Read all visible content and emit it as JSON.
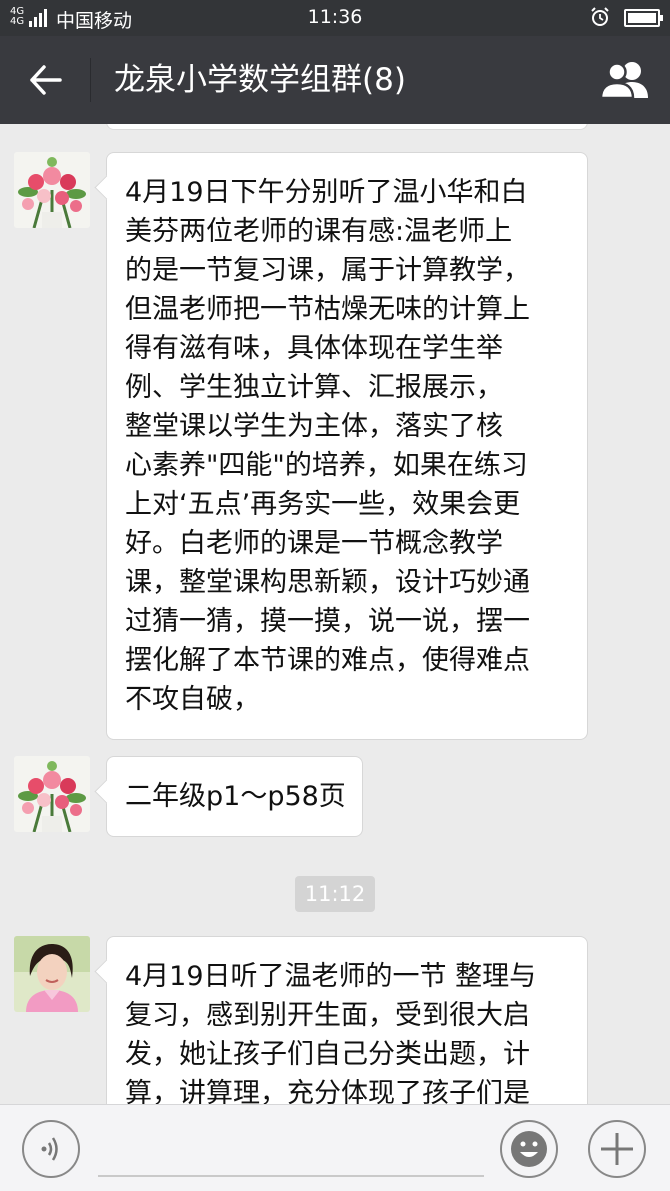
{
  "status_bar": {
    "network_top": "4G",
    "network_bottom": "4G",
    "carrier": "中国移动",
    "time": "11:36",
    "icons": [
      "signal-icon",
      "alarm-icon",
      "battery-icon"
    ],
    "battery_level": 1.0
  },
  "nav": {
    "title": "龙泉小学数学组群(8)",
    "back_icon": "arrow-left-icon",
    "members_icon": "people-icon"
  },
  "messages": [
    {
      "avatar": "flower-bouquet-avatar",
      "lines": [
        "4月19日下午分别听了温小华和白",
        "美芬两位老师的课有感:温老师上",
        "的是一节复习课，属于计算教学，",
        "但温老师把一节枯燥无味的计算上",
        "得有滋有味，具体体现在学生举",
        "例、学生独立计算、汇报展示，",
        "整堂课以学生为主体，落实了核",
        "心素养\"四能\"的培养，如果在练习",
        "上对‘五点’再务实一些，效果会更",
        "好。白老师的课是一节概念教学",
        "课，整堂课构思新颖，设计巧妙通",
        "过猜一猜，摸一摸，说一说，摆一",
        "摆化解了本节课的难点，使得难点",
        "不攻自破，"
      ]
    },
    {
      "avatar": "flower-bouquet-avatar",
      "lines": [
        "二年级p1～p58页"
      ]
    },
    {
      "avatar": "woman-portrait-avatar",
      "lines": [
        "4月19日听了温老师的一节 整理与",
        "复习，感到别开生面，受到很大启",
        "发，她让孩子们自己分类出题，计",
        "算，讲算理，充分体现了孩子们是"
      ]
    }
  ],
  "timestamp": "11:12",
  "input_bar": {
    "voice_icon": "voice-icon",
    "emoji_icon": "emoji-icon",
    "plus_icon": "plus-icon"
  }
}
